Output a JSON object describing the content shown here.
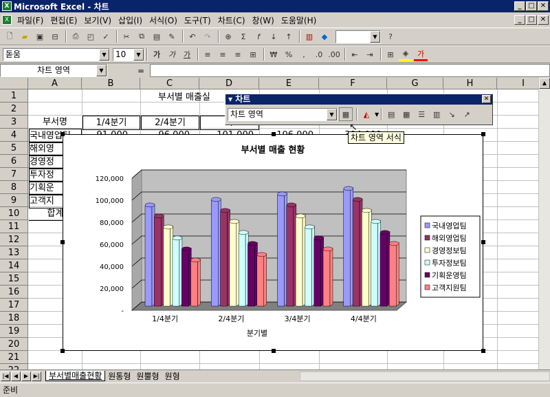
{
  "window": {
    "title": "Microsoft Excel - 차트"
  },
  "menu": [
    "파일(F)",
    "편집(E)",
    "보기(V)",
    "삽입(I)",
    "서식(O)",
    "도구(T)",
    "차트(C)",
    "창(W)",
    "도움말(H)"
  ],
  "toolbar": {
    "font_name": "돋움",
    "font_size": "10",
    "bold": "가",
    "italic": "가",
    "underline": "가",
    "font_color": "가"
  },
  "formula_bar": {
    "name_box": "차트 영역",
    "equals": "="
  },
  "columns": [
    "A",
    "B",
    "C",
    "D",
    "E",
    "F",
    "G",
    "H",
    "I"
  ],
  "rows": [
    "1",
    "2",
    "3",
    "4",
    "5",
    "6",
    "7",
    "8",
    "9",
    "10",
    "11",
    "12",
    "13",
    "14",
    "15",
    "16",
    "17",
    "18",
    "19",
    "20",
    "21",
    "22",
    "23"
  ],
  "cells": {
    "title": "부서별 매출실",
    "header_dept": "부서명",
    "header_q1": "1/4분기",
    "header_q2": "2/4분기",
    "header_q3": "3/",
    "a4": "국내영업팀",
    "a5": "해외영",
    "a6": "경영정",
    "a7": "투자정",
    "a8": "기획운",
    "a9": "고객지",
    "a10": "합계",
    "b4": "91,000",
    "c4": "96,000",
    "d4": "101,000",
    "e4": "106,000",
    "f4": "394,000"
  },
  "chart_toolbar": {
    "title": "차트",
    "object_select": "차트 영역",
    "close": "✕"
  },
  "tooltip": "차트 영역 서식",
  "sheet_tabs": [
    "부서별매출현황",
    "원통형",
    "원뿔형",
    "원형"
  ],
  "status": "준비",
  "colors": {
    "titlebar": "#0a246a",
    "series": [
      "#9999ff",
      "#993366",
      "#ffffcc",
      "#ccffff",
      "#660066",
      "#ff8080"
    ]
  },
  "chart_data": {
    "type": "bar",
    "title": "부서별 매출 현황",
    "xlabel": "분기별",
    "ylabel": "",
    "categories": [
      "1/4분기",
      "2/4분기",
      "3/4분기",
      "4/4분기"
    ],
    "yticks": [
      "-",
      "20,000",
      "40,000",
      "60,000",
      "80,000",
      "100,000",
      "120,000"
    ],
    "ylim": [
      0,
      120000
    ],
    "legend_position": "right",
    "series": [
      {
        "name": "국내영업팀",
        "values": [
          91000,
          96000,
          101000,
          106000
        ]
      },
      {
        "name": "해외영업팀",
        "values": [
          81000,
          86000,
          91000,
          96000
        ]
      },
      {
        "name": "경영정보팀",
        "values": [
          71000,
          76000,
          81000,
          86000
        ]
      },
      {
        "name": "투자정보팀",
        "values": [
          61000,
          66000,
          71000,
          76000
        ]
      },
      {
        "name": "기획운영팀",
        "values": [
          51000,
          56000,
          61000,
          66000
        ]
      },
      {
        "name": "고객지원팀",
        "values": [
          41000,
          46000,
          51000,
          56000
        ]
      }
    ]
  }
}
